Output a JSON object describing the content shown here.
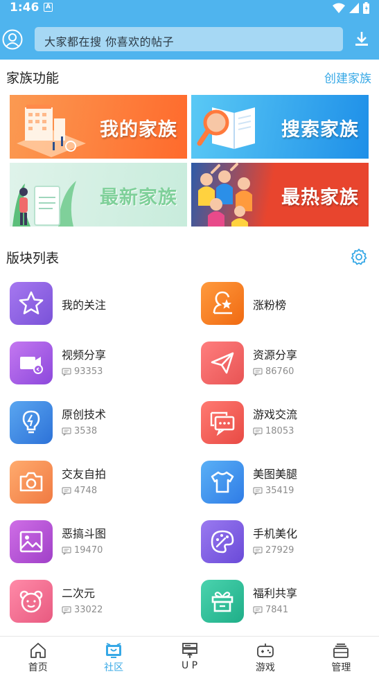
{
  "status_bar": {
    "time": "1:46",
    "notification_badge": "A"
  },
  "header": {
    "search_placeholder": "大家都在搜  你喜欢的帖子"
  },
  "family_section": {
    "title": "家族功能",
    "create_label": "创建家族",
    "banners": [
      {
        "label": "我的家族",
        "color": "#ff7a3d"
      },
      {
        "label": "搜索家族",
        "color": "#1e8fe8"
      },
      {
        "label": "最新家族",
        "color": "#cdeedd"
      },
      {
        "label": "最热家族",
        "color": "#e8452e"
      }
    ]
  },
  "board_section": {
    "title": "版块列表",
    "boards": [
      {
        "name": "我的关注",
        "count": "",
        "icon": "star-icon",
        "color": "#8b64e0"
      },
      {
        "name": "涨粉榜",
        "count": "",
        "icon": "user-star-icon",
        "color": "#f4801e"
      },
      {
        "name": "视频分享",
        "count": "93353",
        "icon": "video-share-icon",
        "color": "#a45ce6"
      },
      {
        "name": "资源分享",
        "count": "86760",
        "icon": "paper-plane-icon",
        "color": "#f26a6a"
      },
      {
        "name": "原创技术",
        "count": "3538",
        "icon": "lightbulb-icon",
        "color": "#3d86e4"
      },
      {
        "name": "游戏交流",
        "count": "18053",
        "icon": "chat-bubbles-icon",
        "color": "#f0605a"
      },
      {
        "name": "交友自拍",
        "count": "4748",
        "icon": "camera-icon",
        "color": "#f5915c"
      },
      {
        "name": "美图美腿",
        "count": "35419",
        "icon": "tshirt-icon",
        "color": "#3c8ef0"
      },
      {
        "name": "恶搞斗图",
        "count": "19470",
        "icon": "picture-icon",
        "color": "#b755d6"
      },
      {
        "name": "手机美化",
        "count": "27929",
        "icon": "palette-icon",
        "color": "#7a5ee6"
      },
      {
        "name": " 二次元",
        "count": "33022",
        "icon": "bear-face-icon",
        "color": "#f06e8e"
      },
      {
        "name": "福利共享",
        "count": "7841",
        "icon": "gift-icon",
        "color": "#2fbd9a"
      }
    ]
  },
  "bottom_nav": {
    "items": [
      {
        "label": "首页",
        "icon": "home-icon"
      },
      {
        "label": "社区",
        "icon": "community-icon"
      },
      {
        "label": "U P",
        "icon": "upload-icon"
      },
      {
        "label": "游戏",
        "icon": "gamepad-icon"
      },
      {
        "label": "管理",
        "icon": "manage-icon"
      }
    ],
    "active_index": 1,
    "active_color": "#36a8e6"
  }
}
